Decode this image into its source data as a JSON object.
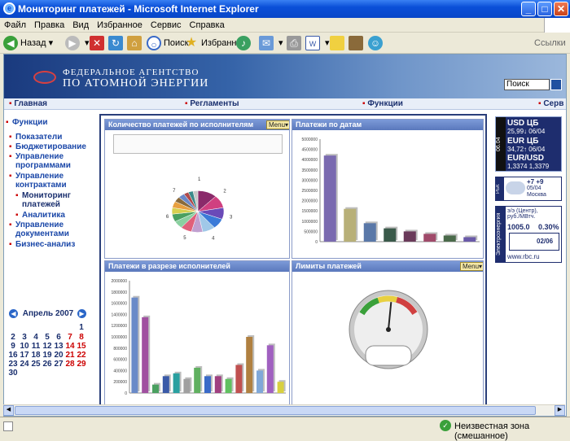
{
  "window": {
    "title": "Мониторинг платежей - Microsoft Internet Explorer"
  },
  "menu": [
    "Файл",
    "Правка",
    "Вид",
    "Избранное",
    "Сервис",
    "Справка"
  ],
  "toolbar": {
    "back": "Назад",
    "search": "Поиск",
    "favorites": "Избранное",
    "links": "Ссылки"
  },
  "banner": {
    "line1": "ФЕДЕРАЛЬНОЕ АГЕНТСТВО",
    "line2": "ПО АТОМНОЙ ЭНЕРГИИ",
    "search_value": "Поиск"
  },
  "nav": [
    "Главная",
    "Регламенты",
    "Функции",
    "Серв"
  ],
  "sidebar": {
    "heading": "Функции",
    "items": [
      "Показатели",
      "Бюджетирование",
      "Управление программами",
      "Управление контрактами",
      "Мониторинг платежей",
      "Аналитика",
      "Управление документами",
      "Бизнес-анализ"
    ]
  },
  "calendar": {
    "title": "Апрель 2007",
    "weeks": [
      [
        "2",
        "3",
        "4",
        "5",
        "6",
        "7",
        "8"
      ],
      [
        "9",
        "10",
        "11",
        "12",
        "13",
        "14",
        "15"
      ],
      [
        "16",
        "17",
        "18",
        "19",
        "20",
        "21",
        "22"
      ],
      [
        "23",
        "24",
        "25",
        "26",
        "27",
        "28",
        "29"
      ],
      [
        "30"
      ]
    ],
    "first_row": [
      "1"
    ]
  },
  "panels": {
    "p1": "Количество платежей по исполнителям",
    "p2": "Платежи по датам",
    "p3": "Платежи в разрезе исполнителей",
    "p4": "Лимиты платежей",
    "menu": "Menu"
  },
  "chart_data": [
    {
      "type": "pie",
      "title": "Количество платежей по исполнителям",
      "values": [
        12,
        10,
        9,
        8,
        8,
        7,
        7,
        6,
        6,
        5,
        5,
        4,
        4,
        3,
        3,
        3
      ],
      "colors": [
        "#8a2a6a",
        "#d04080",
        "#6a4ab8",
        "#3a7ad8",
        "#a0c8e8",
        "#c0a0d0",
        "#e0607a",
        "#8ad0a0",
        "#4aa060",
        "#d8d050",
        "#e8a040",
        "#8a6a3a",
        "#6a88c8",
        "#b04a4a",
        "#3a8a8a",
        "#c8c8c8"
      ],
      "labels": [
        "1",
        "2",
        "3",
        "4",
        "5",
        "6",
        "7"
      ]
    },
    {
      "type": "bar",
      "title": "Платежи по датам",
      "values": [
        4200000,
        1600000,
        900000,
        650000,
        500000,
        380000,
        300000,
        220000
      ],
      "ylim": [
        0,
        5000000
      ],
      "yticks": [
        "5000000",
        "4500000",
        "4000000",
        "3500000",
        "3000000",
        "2500000",
        "2000000",
        "1500000",
        "1000000",
        "500000",
        "0"
      ],
      "colors": [
        "#7a6ab0",
        "#b8b078",
        "#5a78a8",
        "#3a5a4a",
        "#6a3a5a",
        "#a04a6a",
        "#4a6a4a",
        "#6a5aa8"
      ]
    },
    {
      "type": "bar",
      "title": "Платежи в разрезе исполнителей",
      "values": [
        1700000,
        1350000,
        150000,
        300000,
        350000,
        250000,
        450000,
        300000,
        300000,
        250000,
        500000,
        1000000,
        400000,
        850000,
        200000
      ],
      "ylim": [
        0,
        2000000
      ],
      "yticks": [
        "2000000",
        "1800000",
        "1600000",
        "1400000",
        "1200000",
        "1000000",
        "800000",
        "600000",
        "400000",
        "200000",
        "0"
      ],
      "colors": [
        "#6a8ac8",
        "#a050a0",
        "#4aa060",
        "#3a5aa8",
        "#2aa0a0",
        "#a0a0a0",
        "#60b060",
        "#3a6ac8",
        "#a04080",
        "#60c060",
        "#c05050",
        "#b08040",
        "#80a8d8",
        "#a060c0",
        "#d8d040"
      ]
    },
    {
      "type": "gauge",
      "title": "Лимиты платежей",
      "value": 0.55
    }
  ],
  "right": {
    "usd_label": "USD ЦБ",
    "usd": "25,99↓ 06/04",
    "eur_label": "EUR ЦБ",
    "eur": "34,72↑ 06/04",
    "eurusd_label": "EUR/USD",
    "eurusd": "1,3374 1,3379",
    "date_tag": "06.04",
    "weather_temp": "+7 +9",
    "weather_date": "05/04",
    "weather_city": "Москва",
    "rbc": "РБК",
    "power_text": "э/э (Центр),\nруб./МВтч.",
    "power_val": "1005.0",
    "power_pct": "0.30%",
    "power_date": "02/06",
    "power_label": "Электроэнергия",
    "url": "www.rbc.ru"
  },
  "status": {
    "zone": "Неизвестная зона (смешанное)"
  }
}
